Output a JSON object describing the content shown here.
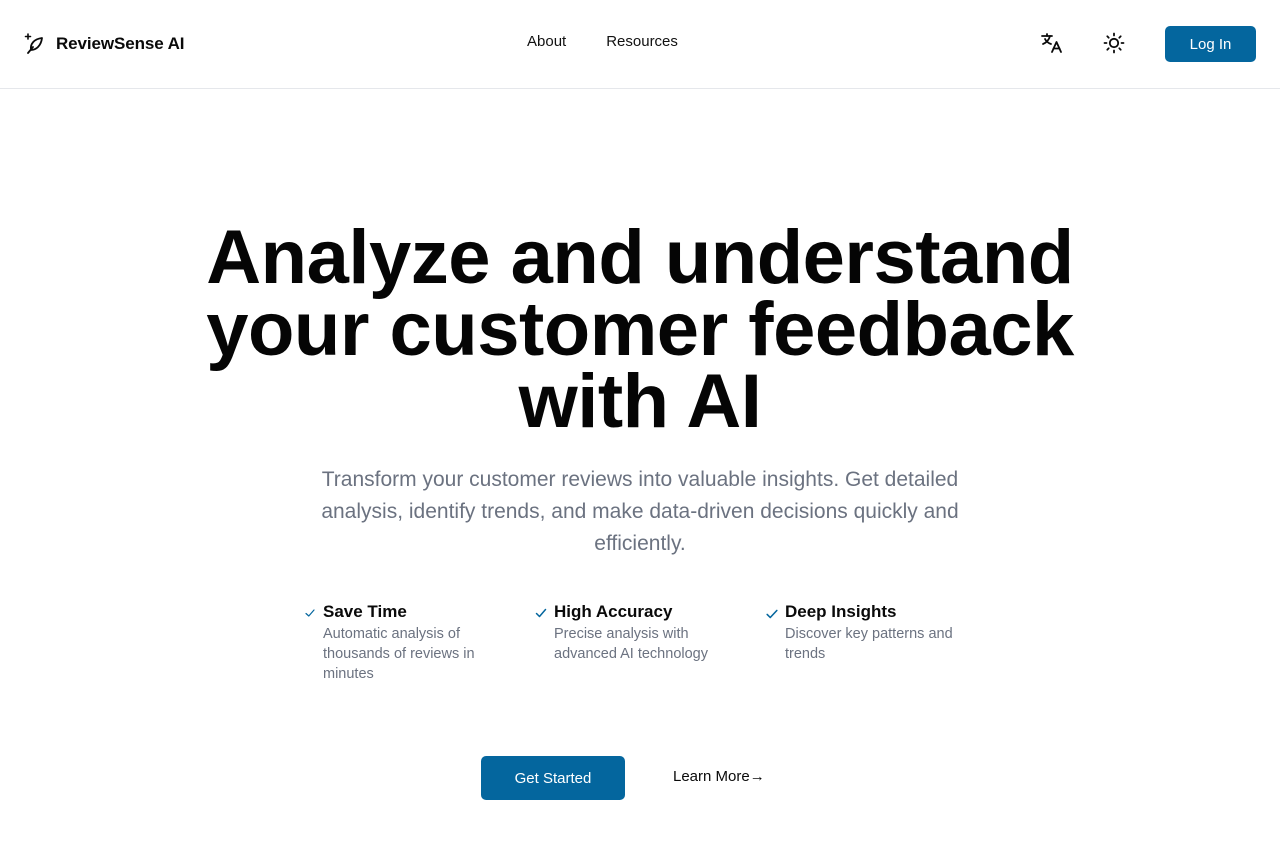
{
  "header": {
    "brand_name": "ReviewSense AI",
    "brand_icon": "sparkle-feather-icon",
    "nav": [
      {
        "label": "About"
      },
      {
        "label": "Resources"
      }
    ],
    "translate_icon": "translate-icon",
    "theme_icon": "sun-icon",
    "login_label": "Log In"
  },
  "hero": {
    "title": "Analyze and understand your customer feedback with AI",
    "subtitle": "Transform your customer reviews into valuable insights. Get detailed analysis, identify trends, and make data-driven decisions quickly and efficiently."
  },
  "features": [
    {
      "title": "Save Time",
      "description": "Automatic analysis of thousands of reviews in minutes",
      "icon": "check-icon"
    },
    {
      "title": "High Accuracy",
      "description": "Precise analysis with advanced AI technology",
      "icon": "check-icon"
    },
    {
      "title": "Deep Insights",
      "description": "Discover key patterns and trends",
      "icon": "check-icon"
    }
  ],
  "cta": {
    "primary_label": "Get Started",
    "secondary_label": "Learn More→"
  },
  "colors": {
    "accent": "#04669e",
    "text": "#0a0a0a",
    "muted": "#6b7280",
    "border": "#e5e7eb"
  }
}
